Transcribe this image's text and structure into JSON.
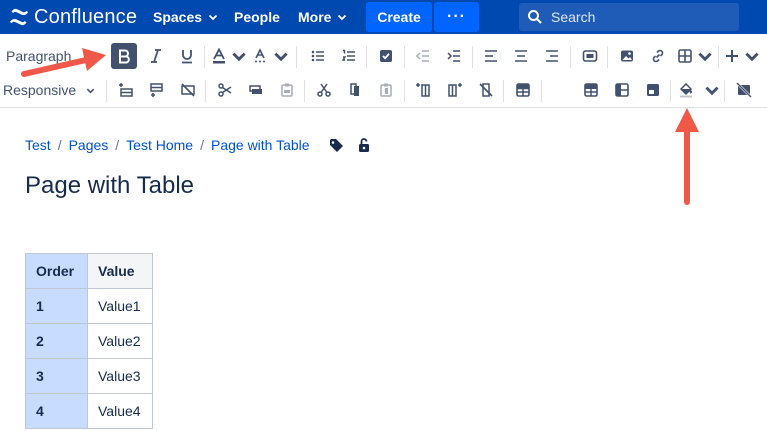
{
  "nav": {
    "brand": "Confluence",
    "items": [
      {
        "label": "Spaces"
      },
      {
        "label": "People"
      },
      {
        "label": "More"
      }
    ],
    "create_label": "Create",
    "more_actions_label": "···",
    "search_placeholder": "Search",
    "brand_color": "#0049b0",
    "accent_color": "#0065ff"
  },
  "toolbar": {
    "paragraph_label": "Paragraph",
    "responsive_label": "Responsive",
    "row1_icons": [
      "bold-icon",
      "italic-icon",
      "underline-icon",
      "text-color-icon",
      "more-formatting-icon",
      "bullet-list-icon",
      "numbered-list-icon",
      "task-list-icon",
      "outdent-icon",
      "indent-icon",
      "align-left-icon",
      "align-center-icon",
      "align-right-icon",
      "page-layout-icon",
      "image-icon",
      "link-icon",
      "table-icon",
      "insert-more-icon"
    ],
    "row2_icons": [
      "insert-row-before-icon",
      "insert-row-after-icon",
      "delete-row-icon",
      "cut-row-icon",
      "copy-row-icon",
      "paste-row-icon",
      "cut-column-icon",
      "copy-column-icon",
      "paste-column-icon",
      "insert-column-before-icon",
      "insert-column-after-icon",
      "delete-column-icon",
      "merge-cells-icon",
      "header-row-icon",
      "header-column-icon",
      "numbered-column-icon",
      "cell-color-icon",
      "delete-table-icon"
    ],
    "active_button": "bold"
  },
  "breadcrumb": [
    "Test",
    "Pages",
    "Test Home",
    "Page with Table"
  ],
  "page": {
    "title": "Page with Table"
  },
  "table": {
    "headers": [
      "Order",
      "Value"
    ],
    "rows": [
      [
        "1",
        "Value1"
      ],
      [
        "2",
        "Value2"
      ],
      [
        "3",
        "Value3"
      ],
      [
        "4",
        "Value4"
      ]
    ],
    "highlight_color": "#c7dcff"
  },
  "annotations": {
    "arrow_color": "#f0584a"
  }
}
